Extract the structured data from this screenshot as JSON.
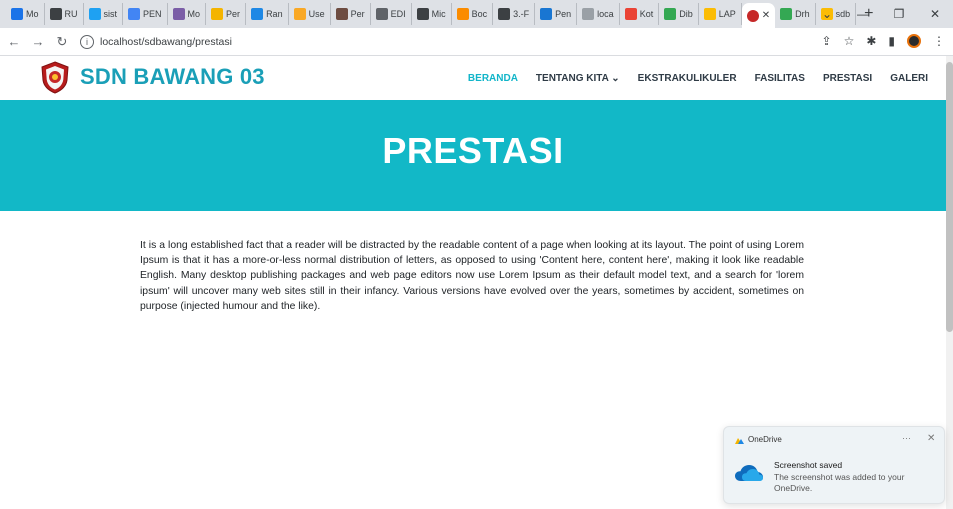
{
  "browser": {
    "tabs": [
      {
        "label": "Mo",
        "color": "#1a73e8"
      },
      {
        "label": "RU",
        "color": "#3c4043"
      },
      {
        "label": "sist",
        "color": "#1ea1f2"
      },
      {
        "label": "PEN",
        "color": "#4285f4"
      },
      {
        "label": "Mo",
        "color": "#7b5ea7"
      },
      {
        "label": "Per",
        "color": "#f4b400"
      },
      {
        "label": "Ran",
        "color": "#1e88e5"
      },
      {
        "label": "Use",
        "color": "#f9a825"
      },
      {
        "label": "Per",
        "color": "#6d4c41"
      },
      {
        "label": "EDI",
        "color": "#5f6368"
      },
      {
        "label": "Mic",
        "color": "#3c4043"
      },
      {
        "label": "Boc",
        "color": "#fb8c00"
      },
      {
        "label": "3.-F",
        "color": "#3c4043"
      },
      {
        "label": "Pen",
        "color": "#1976d2"
      },
      {
        "label": "loca",
        "color": "#9aa0a6"
      },
      {
        "label": "Kot",
        "color": "#ea4335"
      },
      {
        "label": "Dib",
        "color": "#34a853"
      },
      {
        "label": "LAP",
        "color": "#fbbc04"
      },
      {
        "label": "Drh",
        "color": "#34a853"
      },
      {
        "label": "sdb",
        "color": "#fbbc04"
      }
    ],
    "active_tab_color": "#c62828",
    "url": "localhost/sdbawang/prestasi"
  },
  "site": {
    "name": "SDN BAWANG 03",
    "menu": [
      {
        "label": "BERANDA",
        "active": true
      },
      {
        "label": "TENTANG KITA ⌄",
        "active": false
      },
      {
        "label": "EKSTRAKULIKULER",
        "active": false
      },
      {
        "label": "FASILITAS",
        "active": false
      },
      {
        "label": "PRESTASI",
        "active": false
      },
      {
        "label": "GALERI",
        "active": false
      }
    ],
    "hero_title": "PRESTASI",
    "body_text": "It is a long established fact that a reader will be distracted by the readable content of a page when looking at its layout. The point of using Lorem Ipsum is that it has a more-or-less normal distribution of letters, as opposed to using 'Content here, content here', making it look like readable English. Many desktop publishing packages and web page editors now use Lorem Ipsum as their default model text, and a search for 'lorem ipsum' will uncover many web sites still in their infancy. Various versions have evolved over the years, sometimes by accident, sometimes on purpose (injected humour and the like).",
    "brand_color": "#1a9fb7",
    "hero_color": "#12b8c7"
  },
  "toast": {
    "app": "OneDrive",
    "title": "Screenshot saved",
    "body": "The screenshot was added to your OneDrive.",
    "more": "···",
    "close": "✕"
  }
}
